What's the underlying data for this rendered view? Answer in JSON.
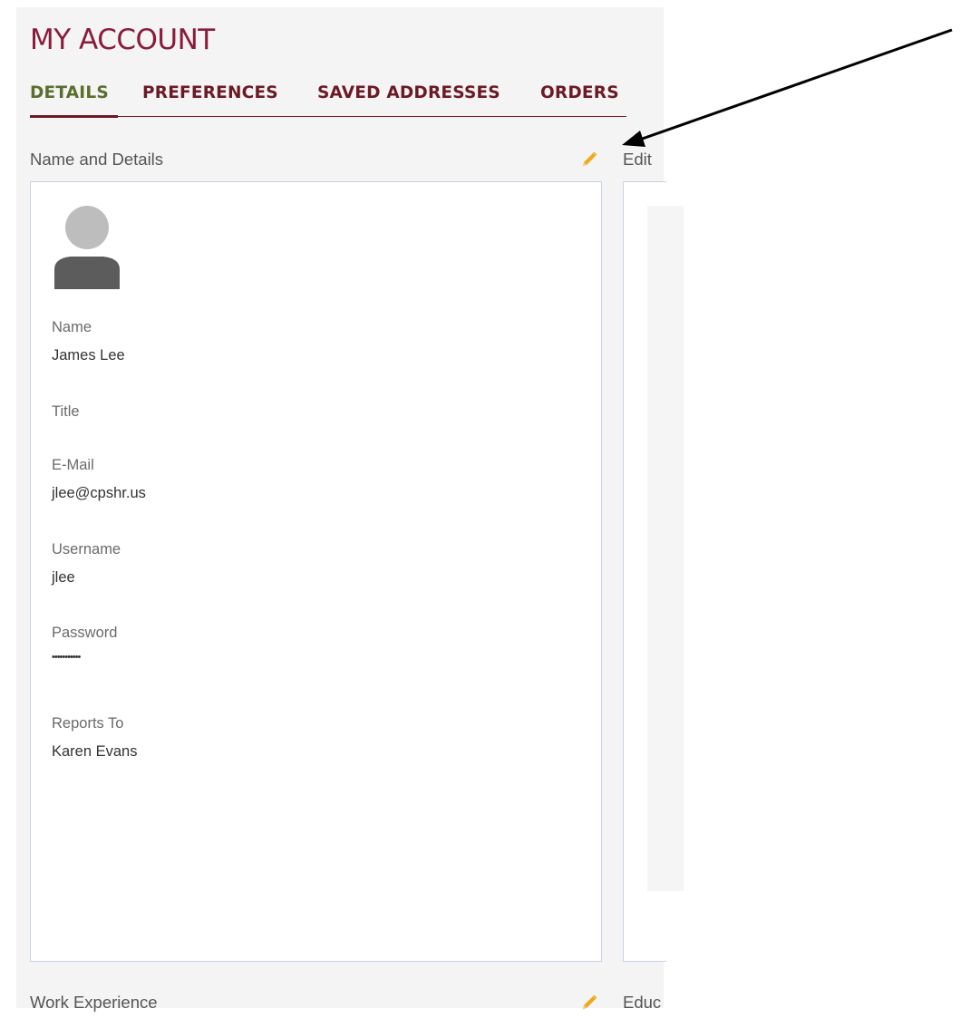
{
  "page": {
    "title": "MY ACCOUNT"
  },
  "tabs": [
    {
      "label": "DETAILS",
      "active": true
    },
    {
      "label": "PREFERENCES",
      "active": false
    },
    {
      "label": "SAVED ADDRESSES",
      "active": false
    },
    {
      "label": "ORDERS",
      "active": false
    }
  ],
  "colors": {
    "title": "#8a1b3c",
    "tab_text": "#6b1a26",
    "tab_active": "#5a6e2e",
    "edit_icon": "#f0a81c",
    "card_border": "#c8d3e0"
  },
  "sections": {
    "name_details": {
      "label": "Name and Details",
      "edit_icon": "pencil-icon",
      "avatar_icon": "user-avatar-icon",
      "fields": [
        {
          "label": "Name",
          "value": "James Lee"
        },
        {
          "label": "Title",
          "value": ""
        },
        {
          "label": "E-Mail",
          "value": "jlee@cpshr.us"
        },
        {
          "label": "Username",
          "value": "jlee"
        },
        {
          "label": "Password",
          "value": "•••••••••••"
        },
        {
          "label": "Reports To",
          "value": "Karen Evans"
        }
      ]
    },
    "edit_panel": {
      "label": "Edit"
    },
    "work_experience": {
      "label": "Work Experience",
      "edit_icon": "pencil-icon"
    },
    "education": {
      "label": "Educ"
    }
  }
}
